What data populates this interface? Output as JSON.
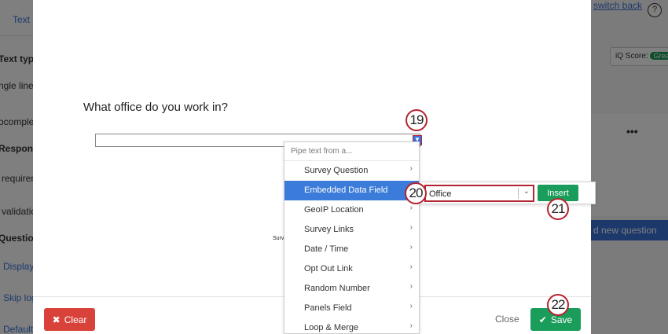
{
  "background": {
    "left_tab": "Text",
    "left_labels": [
      "Text typ",
      "ngle line",
      "ocomplet",
      "Respons",
      "requirem",
      "validatio",
      "Questio",
      "Display",
      "Skip log",
      "Default"
    ],
    "switch_back": "switch back",
    "help": "?",
    "iq_score_label": "iQ Score:",
    "iq_score_value": "Grea",
    "card_menu": "•••",
    "add_question": "d new question"
  },
  "modal": {
    "question_text": "What office do you work in?",
    "survey_text": "Surv",
    "clear_label": "Clear",
    "close_label": "Close",
    "save_label": "Save"
  },
  "pipe_menu": {
    "header": "Pipe text from a...",
    "items": [
      {
        "label": "Survey Question",
        "has_submenu": true
      },
      {
        "label": "Embedded Data Field",
        "has_submenu": false,
        "active": true
      },
      {
        "label": "GeoIP Location",
        "has_submenu": true
      },
      {
        "label": "Survey Links",
        "has_submenu": true
      },
      {
        "label": "Date / Time",
        "has_submenu": true
      },
      {
        "label": "Opt Out Link",
        "has_submenu": true
      },
      {
        "label": "Random Number",
        "has_submenu": true
      },
      {
        "label": "Panels Field",
        "has_submenu": true
      },
      {
        "label": "Loop & Merge",
        "has_submenu": true
      }
    ]
  },
  "embedded_field": {
    "value": "Office",
    "insert_label": "Insert"
  },
  "callouts": [
    "19",
    "20",
    "21",
    "22"
  ],
  "colors": {
    "accent_blue": "#3b7bd9",
    "save_green": "#1a9c5a",
    "clear_red": "#d9423b",
    "callout_red": "#b42330"
  },
  "icons": {
    "clear": "x-icon",
    "save": "check-icon",
    "submenu": "chevron-right-icon",
    "dropdown": "chevron-down-icon"
  }
}
